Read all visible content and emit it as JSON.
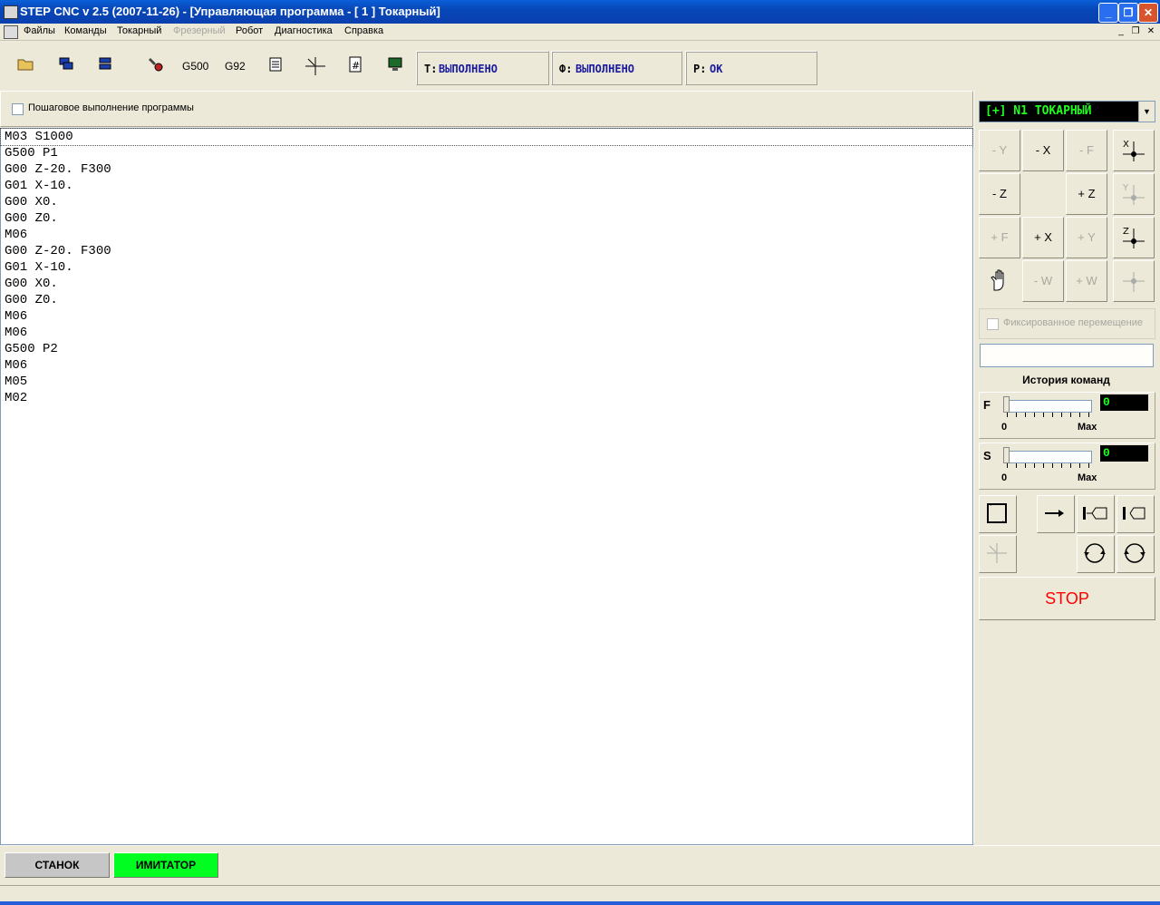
{
  "window": {
    "title": "STEP CNC v 2.5 (2007-11-26) - [Управляющая программа - [ 1 ] Токарный]"
  },
  "menu": [
    {
      "label": "Файлы",
      "enabled": true
    },
    {
      "label": "Команды",
      "enabled": true
    },
    {
      "label": "Токарный",
      "enabled": true
    },
    {
      "label": "Фрезерный",
      "enabled": false
    },
    {
      "label": "Робот",
      "enabled": true
    },
    {
      "label": "Диагностика",
      "enabled": true
    },
    {
      "label": "Справка",
      "enabled": true
    }
  ],
  "toolbar": {
    "g500_label": "G500",
    "g92_label": "G92",
    "status_t_label": "T:",
    "status_t_value": "ВЫПОЛНЕНО",
    "status_f_label": "Ф:",
    "status_f_value": "ВЫПОЛНЕНО",
    "status_p_label": "P:",
    "status_p_value": "OK"
  },
  "step_mode": {
    "label": "Пошаговое выполнение программы",
    "checked": false
  },
  "program_lines": [
    "M03 S1000",
    "G500 P1",
    "G00 Z-20. F300",
    "G01 X-10.",
    "G00 X0.",
    "G00 Z0.",
    "M06",
    "G00 Z-20. F300",
    "G01 X-10.",
    "G00 X0.",
    "G00 Z0.",
    "M06",
    "M06",
    "G500 P2",
    "M06",
    "M05",
    "M02"
  ],
  "right_panel": {
    "mode_select": "[+] N1 ТОКАРНЫЙ",
    "jog": {
      "minus_y": "- Y",
      "minus_x": "- X",
      "minus_f": "- F",
      "minus_z": "- Z",
      "plus_z": "+ Z",
      "plus_f": "+ F",
      "plus_x": "+ X",
      "plus_y": "+ Y",
      "minus_w": "- W",
      "plus_w": "+ W",
      "x_zero": "X",
      "y_zero": "Y",
      "z_zero": "Z"
    },
    "fixed_move_label": "Фиксированное перемещение",
    "history_title": "История команд",
    "feed": {
      "letter": "F",
      "value": "0",
      "min": "0",
      "max": "Max"
    },
    "spindle": {
      "letter": "S",
      "value": "0",
      "min": "0",
      "max": "Max"
    },
    "stop_label": "STOP"
  },
  "bottom": {
    "machine_label": "СТАНОК",
    "simulator_label": "ИМИТАТОР"
  },
  "colors": {
    "title_bar": "#0a50c8",
    "simulator_active": "#00ff20",
    "stop_text": "#ff0000",
    "status_value": "#1a1a9f",
    "display_green": "#20ff20"
  }
}
